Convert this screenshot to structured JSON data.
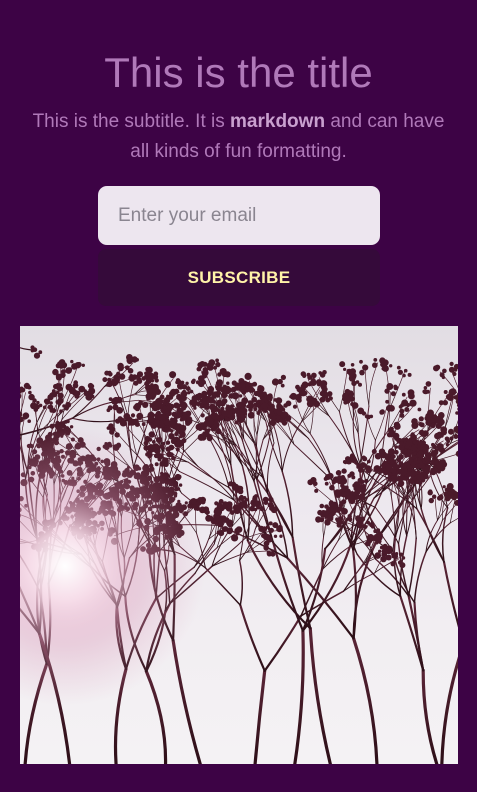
{
  "hero": {
    "title": "This is the title",
    "subtitle_lead": "This is the subtitle. It is ",
    "subtitle_bold": "markdown",
    "subtitle_tail": " and can have all kinds of fun formatting."
  },
  "signup": {
    "email_placeholder": "Enter your email",
    "email_value": "",
    "subscribe_label": "SUBSCRIBE"
  },
  "colors": {
    "page_background": "#3d0345",
    "title_text": "#b079b9",
    "button_background": "#350a3a",
    "button_text": "#fff3a8",
    "input_background": "#ede6ef"
  },
  "image": {
    "subject": "silhouetted branches against bright sky with sun glare"
  }
}
